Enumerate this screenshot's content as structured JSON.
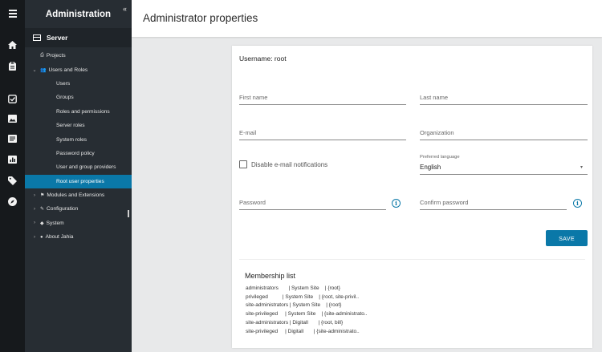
{
  "rail": {
    "icons": [
      "menu-icon",
      "home-icon",
      "clipboard-icon",
      "site-icon",
      "image-icon",
      "list-icon",
      "chart-icon",
      "tag-icon",
      "compass-icon"
    ]
  },
  "sidebar": {
    "title": "Administration",
    "collapse_glyph": "«",
    "section": "Server",
    "items": [
      {
        "label": "Projects",
        "arrow": "",
        "glyph": "⎙"
      },
      {
        "label": "Users and Roles",
        "arrow": "⌄",
        "glyph": "👥"
      },
      {
        "label": "Users"
      },
      {
        "label": "Groups"
      },
      {
        "label": "Roles and permissions"
      },
      {
        "label": "Server roles"
      },
      {
        "label": "System roles"
      },
      {
        "label": "Password policy"
      },
      {
        "label": "User and group providers"
      },
      {
        "label": "Root user properties"
      },
      {
        "label": "Modules and Extensions",
        "arrow": "›",
        "glyph": "⚑"
      },
      {
        "label": "Configuration",
        "arrow": "›",
        "glyph": "✎"
      },
      {
        "label": "System",
        "arrow": "›",
        "glyph": "◆"
      },
      {
        "label": "About Jahia",
        "arrow": "›",
        "glyph": "●"
      }
    ]
  },
  "header": {
    "title": "Administrator properties"
  },
  "form": {
    "username": "Username: root",
    "first_name_placeholder": "First name",
    "last_name_placeholder": "Last name",
    "email_placeholder": "E-mail",
    "organization_placeholder": "Organization",
    "disable_email_label": "Disable e-mail notifications",
    "language_label": "Preferred language",
    "language_value": "English",
    "password_placeholder": "Password",
    "confirm_password_placeholder": "Confirm password",
    "info_glyph": "i",
    "dropdown_glyph": "▾",
    "save_label": "SAVE"
  },
  "membership": {
    "title": "Membership list",
    "rows": [
      "administrators       | System Site    | {root}",
      "privileged          | System Site    | {root, site-privil..",
      "site-administrators | System Site    | {root}",
      "site-privileged     | System Site    | {site-administrato..",
      "site-administrators | Digitall       | {root, bill}",
      "site-privileged     | Digitall       | {site-administrato.."
    ]
  },
  "colors": {
    "accent": "#0a78a8",
    "sidebar_bg": "#272d33",
    "rail_bg": "#16191c"
  }
}
